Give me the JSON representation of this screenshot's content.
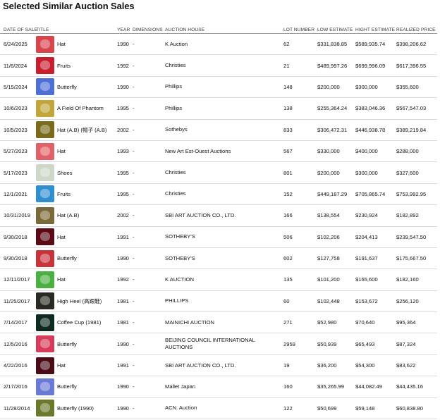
{
  "page": {
    "heading": "Selected Similar Auction Sales"
  },
  "columns": {
    "date": "DATE OF SALE",
    "title": "TITLE",
    "year": "YEAR",
    "dimensions": "DIMENSIONS",
    "house": "AUCTION HOUSE",
    "lot": "LOT NUMBER",
    "low": "LOW ESTIMATE",
    "high": "HIGHT ESTIMATE",
    "realized": "REALIZED PRICE"
  },
  "thumb_colors": [
    "#d8434c",
    "#c81e2e",
    "#4f6fd8",
    "#c4a53a",
    "#7a6a1c",
    "#e0606a",
    "#cfd8c8",
    "#2f8fd0",
    "#7a6a3a",
    "#5a0a14",
    "#c8343c",
    "#4ab040",
    "#2a2a22",
    "#0f2a20",
    "#d83a5a",
    "#4a0a16",
    "#6a7ad8",
    "#6a7a2a"
  ],
  "rows": [
    {
      "date": "6/24/2025",
      "title": "Hat",
      "year": "1990",
      "dim": "-",
      "house": "K Auction",
      "lot": "62",
      "low": "$331,838.85",
      "high": "$589,935.74",
      "realized": "$398,206.62"
    },
    {
      "date": "11/6/2024",
      "title": "Fruits",
      "year": "1992",
      "dim": "-",
      "house": "Christies",
      "lot": "21",
      "low": "$489,997.26",
      "high": "$699,996.09",
      "realized": "$617,396.55"
    },
    {
      "date": "5/15/2024",
      "title": "Butterfly",
      "year": "1990",
      "dim": "-",
      "house": "Phillips",
      "lot": "148",
      "low": "$200,000",
      "high": "$300,000",
      "realized": "$355,600"
    },
    {
      "date": "10/6/2023",
      "title": "A Field Of Phantom",
      "year": "1995",
      "dim": "-",
      "house": "Phillips",
      "lot": "138",
      "low": "$255,364.24",
      "high": "$383,046.36",
      "realized": "$567,547.03"
    },
    {
      "date": "10/5/2023",
      "title": "Hat (A.B) (帽子 (A.B)",
      "year": "2002",
      "dim": "-",
      "house": "Sothebys",
      "lot": "833",
      "low": "$306,472.31",
      "high": "$446,938.78",
      "realized": "$389,219.84"
    },
    {
      "date": "5/27/2023",
      "title": "Hat",
      "year": "1993",
      "dim": "-",
      "house": "New Art Est-Ouest Auctions",
      "lot": "567",
      "low": "$330,000",
      "high": "$400,000",
      "realized": "$288,000"
    },
    {
      "date": "5/17/2023",
      "title": "Shoes",
      "year": "1995",
      "dim": "-",
      "house": "Christies",
      "lot": "801",
      "low": "$200,000",
      "high": "$300,000",
      "realized": "$327,600"
    },
    {
      "date": "12/1/2021",
      "title": "Fruits",
      "year": "1995",
      "dim": "-",
      "house": "Christies",
      "lot": "152",
      "low": "$449,187.29",
      "high": "$705,865.74",
      "realized": "$753,992.95"
    },
    {
      "date": "10/31/2019",
      "title": "Hat (A.B)",
      "year": "2002",
      "dim": "-",
      "house": "SBI ART AUCTION CO., LTD.",
      "lot": "166",
      "low": "$138,554",
      "high": "$230,924",
      "realized": "$182,892"
    },
    {
      "date": "9/30/2018",
      "title": "Hat",
      "year": "1991",
      "dim": "-",
      "house": "SOTHEBY'S",
      "lot": "506",
      "low": "$102,206",
      "high": "$204,413",
      "realized": "$239,547.50"
    },
    {
      "date": "9/30/2018",
      "title": "Butterfly",
      "year": "1990",
      "dim": "-",
      "house": "SOTHEBY'S",
      "lot": "602",
      "low": "$127,758",
      "high": "$191,637",
      "realized": "$175,667.50"
    },
    {
      "date": "12/11/2017",
      "title": "Hat",
      "year": "1992",
      "dim": "-",
      "house": "K AUCTION",
      "lot": "135",
      "low": "$101,200",
      "high": "$165,600",
      "realized": "$182,160"
    },
    {
      "date": "11/25/2017",
      "title": "High Heel (高跟鞋)",
      "year": "1981",
      "dim": "-",
      "house": "PHILLIPS",
      "lot": "60",
      "low": "$102,448",
      "high": "$153,672",
      "realized": "$256,120"
    },
    {
      "date": "7/14/2017",
      "title": "Coffee Cup (1981)",
      "year": "1981",
      "dim": "-",
      "house": "MAINICHI AUCTION",
      "lot": "271",
      "low": "$52,980",
      "high": "$70,640",
      "realized": "$95,364"
    },
    {
      "date": "12/5/2016",
      "title": "Butterfly",
      "year": "1990",
      "dim": "-",
      "house": "BEIJING COUNCIL INTERNATIONAL AUCTIONS",
      "lot": "2959",
      "low": "$50,939",
      "high": "$65,493",
      "realized": "$87,324"
    },
    {
      "date": "4/22/2016",
      "title": "Hat",
      "year": "1991",
      "dim": "-",
      "house": "SBI ART AUCTION CO., LTD.",
      "lot": "19",
      "low": "$36,200",
      "high": "$54,300",
      "realized": "$83,622"
    },
    {
      "date": "2/17/2016",
      "title": "Butterfly",
      "year": "1990",
      "dim": "-",
      "house": "Mallet Japan",
      "lot": "160",
      "low": "$35,265.99",
      "high": "$44,082.49",
      "realized": "$44,435.16"
    },
    {
      "date": "11/28/2014",
      "title": "Butterfly (1990)",
      "year": "1990",
      "dim": "-",
      "house": "ACN. Auction",
      "lot": "122",
      "low": "$50,699",
      "high": "$59,148",
      "realized": "$60,838.80"
    }
  ]
}
